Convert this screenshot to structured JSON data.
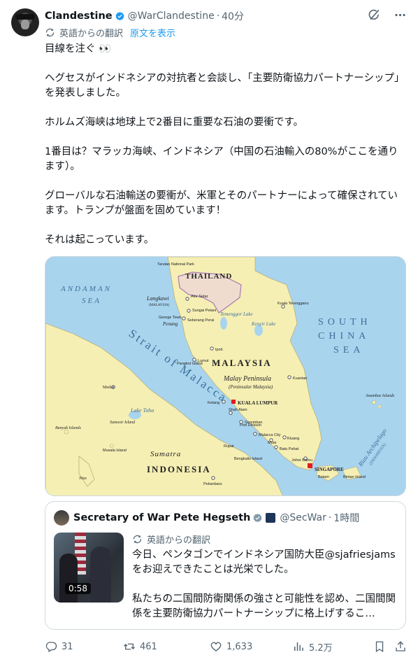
{
  "author": {
    "display_name": "Clandestine",
    "handle": "@WarClandestine",
    "separator": "·",
    "time": "40分"
  },
  "translation": {
    "label": "英語からの翻訳",
    "show_original": "原文を表示"
  },
  "body": [
    "目線を注ぐ 👀",
    "ヘグセスがインドネシアの対抗者と会談し、「主要防衛協力パートナーシップ」を発表しました。",
    "ホルムズ海峡は地球上で2番目に重要な石油の要衝です。",
    "1番目は？マラッカ海峡、インドネシア（中国の石油輸入の80%がここを通ります）。",
    "グローバルな石油輸送の要衝が、米軍とそのパートナーによって確保されています。トランプが盤面を固めています！",
    "それは起こっています。"
  ],
  "map": {
    "labels": {
      "thailand": "THAILAND",
      "andaman_sea_1": "ANDAMAN",
      "andaman_sea_2": "SEA",
      "south_china_1": "SOUTH",
      "south_china_2": "CHINA",
      "south_china_3": "SEA",
      "malaysia": "MALAYSIA",
      "malay_peninsula": "Malay Peninsula",
      "peninsular_malaysia": "(Peninsular Malaysia)",
      "strait": "Strait of Malacca",
      "indonesia": "INDONESIA",
      "sumatra": "Sumatra",
      "kuala_lumpur": "KUALA LUMPUR",
      "singapore": "SINGAPORE",
      "riau": "Riau Archipelago",
      "riau_sub": "(INDONESIA)",
      "langkawi": "Langkawi",
      "langkawi_sub": "(MALAYSIA)",
      "penang": "Penang",
      "george_town": "George Town",
      "alor_setar": "Alor Setar",
      "sungai_petani": "Sungai Petani",
      "seberang_perai": "Seberang Perai",
      "temenggor": "Temenggor Lake",
      "kenyir": "Kenyir Lake",
      "kuala_terengganu": "Kuala Terengganu",
      "ipoh": "Ipoh",
      "lumut": "Lumut",
      "pangkor": "Pangkor Island",
      "kuantan": "Kuantan",
      "medan": "Medan",
      "lake_toba": "Lake Toba",
      "samosir": "Samosir Island",
      "banyak": "Banyak Islands",
      "nias": "Nias",
      "kelang": "Kelang",
      "shah_alam": "Shah Alam",
      "seremban": "Seremban",
      "port_dickson": "Port Dickson",
      "malacca_city": "Malacca City",
      "muar": "Muar",
      "kluang": "Kluang",
      "batu_pahat": "Batu Pahat",
      "johor_bahru": "Johor Bahru",
      "batam": "Batam",
      "bintan": "Bintan Island",
      "anambas": "Anambas Islands",
      "pekanbaru": "Pekanbaru",
      "rupat": "Rupat",
      "bengkalis": "Bengkalis Island",
      "tarutao": "Tarutao National Park",
      "musala": "Musala Island"
    }
  },
  "quote": {
    "display_name": "Secretary of War Pete Hegseth",
    "handle": "@SecWar",
    "separator": "·",
    "time": "1時間",
    "translation_label": "英語からの翻訳",
    "video_duration": "0:58",
    "text": [
      "今日、ペンタゴンでインドネシア国防大臣@sjafriesjamsをお迎えできたことは光栄でした。",
      "私たちの二国間防衛関係の強さと可能性を認め、二国間関係を主要防衛協力パートナーシップに格上げするこ…"
    ]
  },
  "actions": {
    "replies": "31",
    "reposts": "461",
    "likes": "1,633",
    "views": "5.2万"
  },
  "colors": {
    "accent": "#1d9bf0",
    "secondary_text": "#536471",
    "border": "#cfd9de",
    "sea": "#a8d4ee",
    "land": "#f6efb4"
  }
}
